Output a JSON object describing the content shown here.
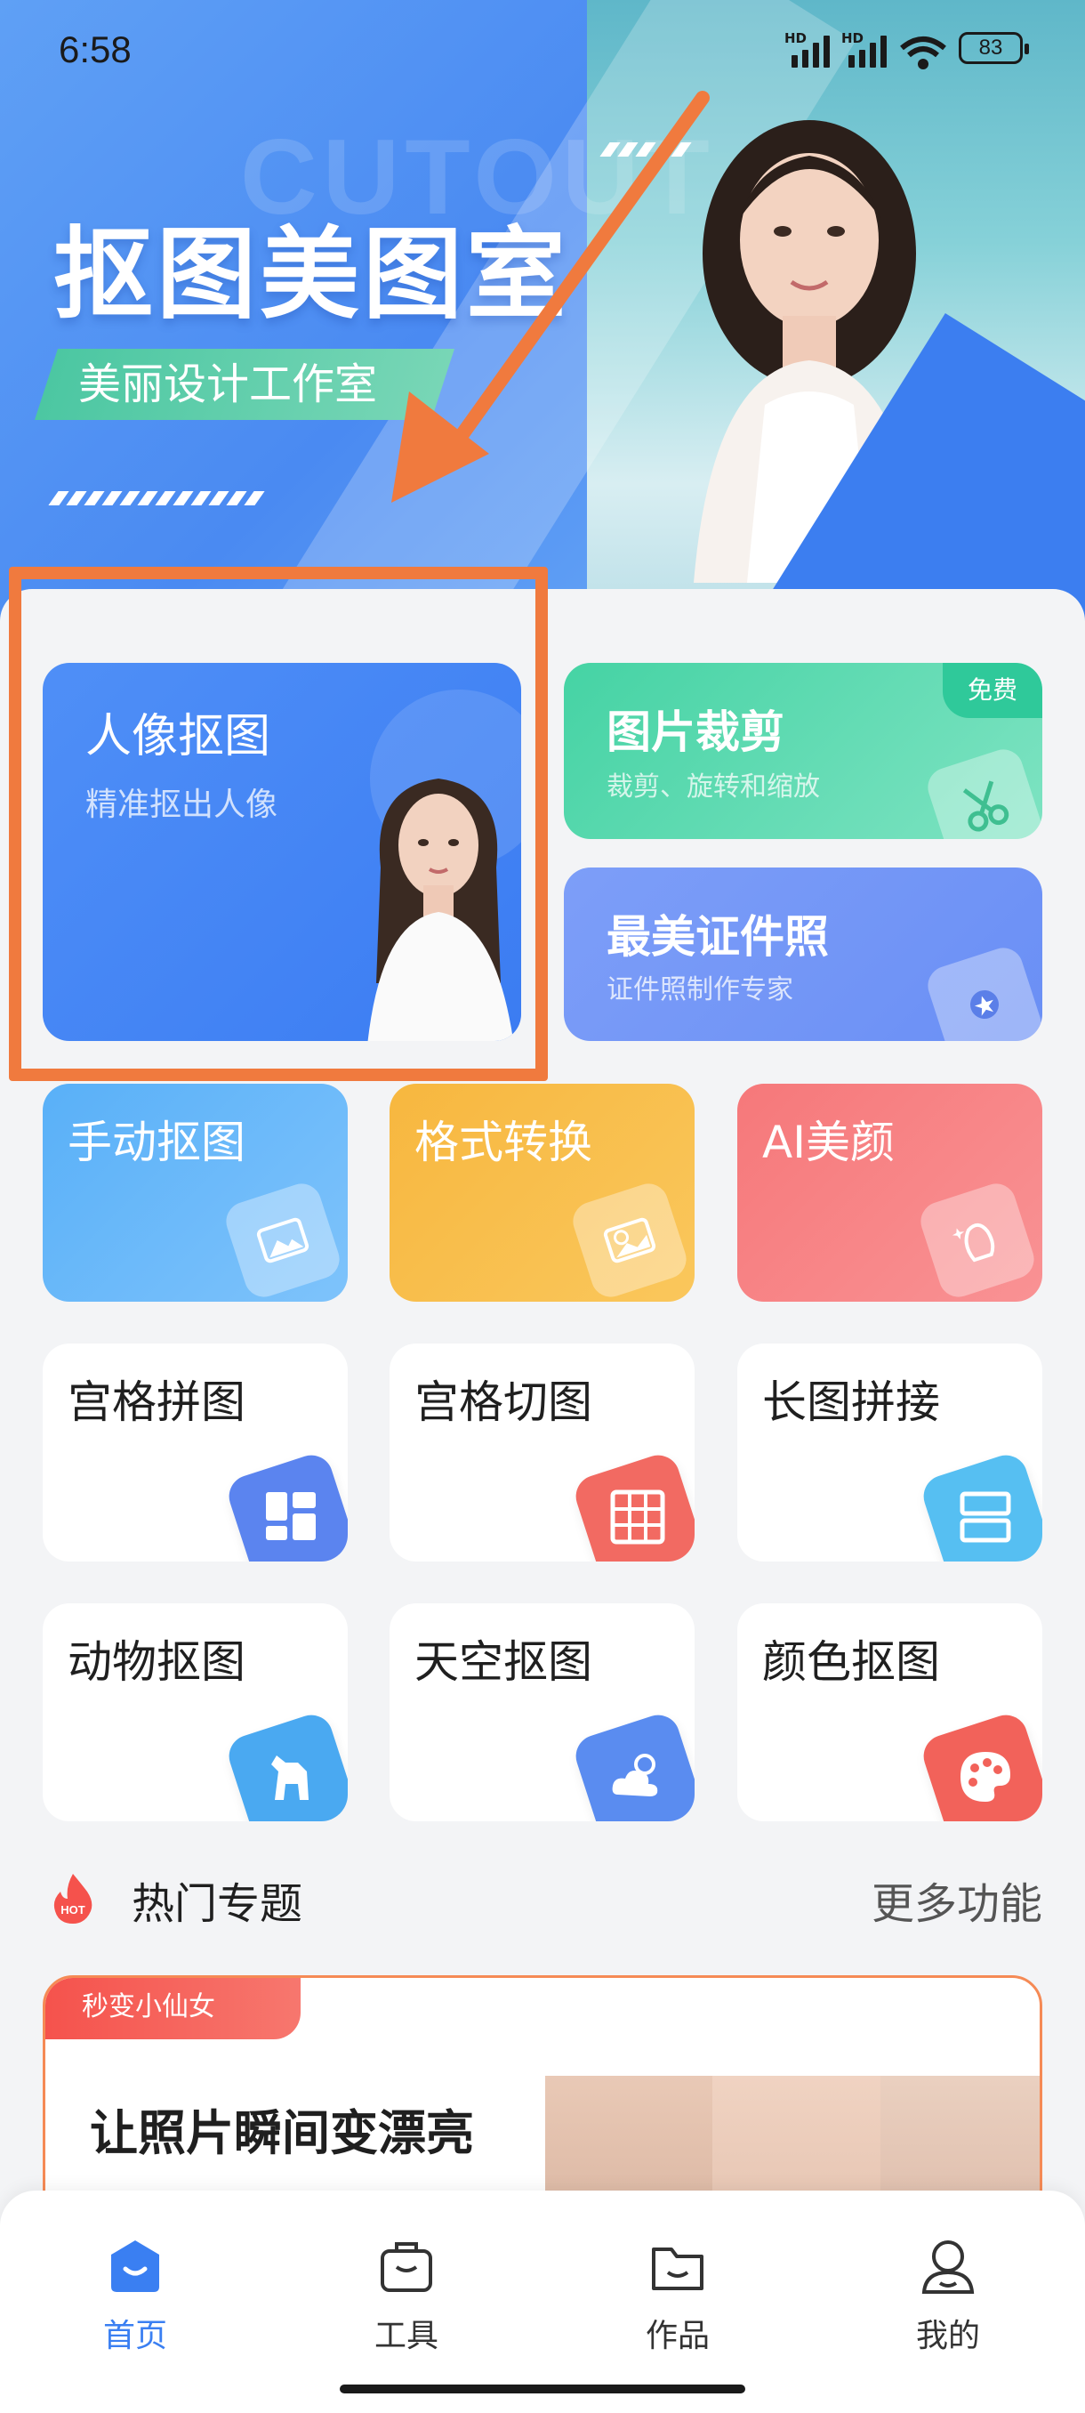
{
  "status_bar": {
    "time": "6:58",
    "network1": "HD",
    "network2": "HD",
    "wifi_sub": "6",
    "battery": "83"
  },
  "banner": {
    "title": "抠图美图室",
    "subtitle": "美丽设计工作室",
    "watermark": "CUTOUT"
  },
  "features": {
    "portrait": {
      "title": "人像抠图",
      "desc": "精准抠出人像"
    },
    "crop": {
      "title": "图片裁剪",
      "desc": "裁剪、旋转和缩放",
      "badge": "免费"
    },
    "idphoto": {
      "title": "最美证件照",
      "desc": "证件照制作专家"
    },
    "manual": {
      "title": "手动抠图"
    },
    "format": {
      "title": "格式转换"
    },
    "beauty": {
      "title": "AI美颜"
    },
    "grid_collage": {
      "title": "宫格拼图"
    },
    "grid_cut": {
      "title": "宫格切图"
    },
    "long_stitch": {
      "title": "长图拼接"
    },
    "animal": {
      "title": "动物抠图"
    },
    "sky": {
      "title": "天空抠图"
    },
    "color": {
      "title": "颜色抠图"
    }
  },
  "hot": {
    "title": "热门专题",
    "more": "更多功能",
    "badge_text": "HOT"
  },
  "promo": {
    "tag": "秒变小仙女",
    "title": "让照片瞬间变漂亮"
  },
  "nav": [
    {
      "label": "首页",
      "icon": "home-icon",
      "active": true
    },
    {
      "label": "工具",
      "icon": "toolbox-icon",
      "active": false
    },
    {
      "label": "作品",
      "icon": "folder-icon",
      "active": false
    },
    {
      "label": "我的",
      "icon": "profile-icon",
      "active": false
    }
  ],
  "colors": {
    "accent": "#3a7ff2",
    "annotation": "#f07a3e",
    "hot_red": "#f5524c"
  }
}
